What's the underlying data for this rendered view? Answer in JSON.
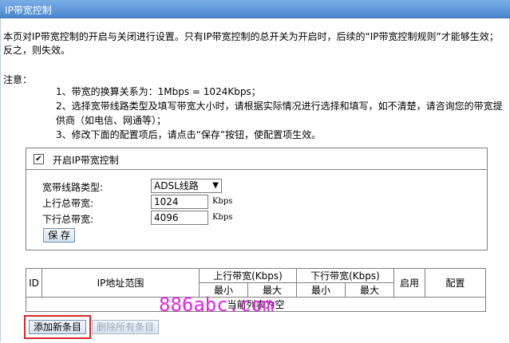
{
  "window": {
    "title": "IP带宽控制"
  },
  "description": "本页对IP带宽控制的开启与关闭进行设置。只有IP带宽控制的总开关为开启时，后续的“IP带宽控制规则”才能够生效；反之，则失效。",
  "notes": {
    "title": "注意：",
    "items": [
      "1、带宽的换算关系为：1Mbps = 1024Kbps；",
      "2、选择宽带线路类型及填写带宽大小时，请根据实际情况进行选择和填写，如不清楚，请咨询您的带宽提供商（如电信、网通等）；",
      "3、修改下面的配置项后，请点击“保存”按钮，使配置项生效。"
    ]
  },
  "settings": {
    "enable_label": "开启IP带宽控制",
    "enable_checked": true,
    "line_type_label": "宽带线路类型:",
    "line_type_value": "ADSL线路",
    "upload_label": "上行总带宽:",
    "upload_value": "1024",
    "download_label": "下行总带宽:",
    "download_value": "4096",
    "unit": "Kbps",
    "save_label": "保 存"
  },
  "rules_table": {
    "col_id": "ID",
    "col_ip_range": "IP地址范围",
    "col_upload": "上行带宽(Kbps)",
    "col_download": "下行带宽(Kbps)",
    "col_min": "最小",
    "col_max": "最大",
    "col_enabled": "启用",
    "col_config": "配置",
    "empty_text": "当前列表为空"
  },
  "actions": {
    "add_label": "添加新条目",
    "delete_all_label": "删除所有条目"
  },
  "watermark": "886abc.com",
  "colors": {
    "title_bar": "#4a86cf",
    "highlight": "#d6262b",
    "watermark": "#e327e3"
  }
}
